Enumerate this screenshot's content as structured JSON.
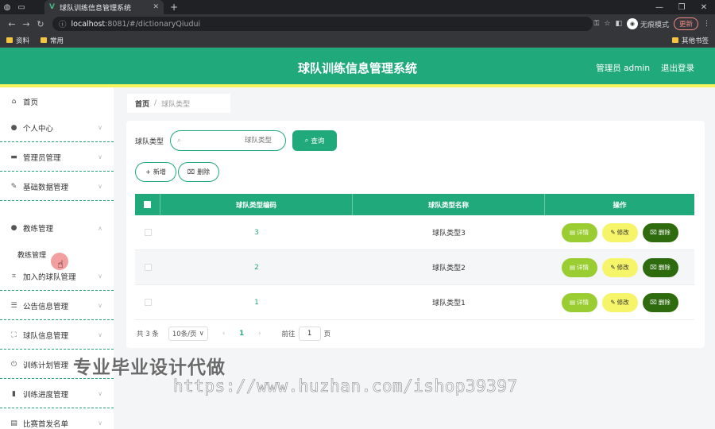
{
  "browser": {
    "tab_title": "球队训练信息管理系统",
    "tab_favicon": "V",
    "url_host": "localhost",
    "url_rest": ":8081/#/dictionaryQiudui",
    "incognito_label": "无痕模式",
    "update_label": "更新",
    "bookmarks": [
      "资料",
      "常用"
    ],
    "other_bookmarks": "其他书签"
  },
  "header": {
    "title": "球队训练信息管理系统",
    "user": "管理员 admin",
    "logout": "退出登录",
    "bg_color": "#20aa7b",
    "stripe_color": "#f5f25d"
  },
  "sidebar": {
    "items": [
      {
        "label": "首页",
        "icon": "home-icon",
        "chevron": false
      },
      {
        "label": "个人中心",
        "icon": "user-icon",
        "chevron": true
      },
      {
        "label": "管理员管理",
        "icon": "briefcase-icon",
        "chevron": true
      },
      {
        "label": "基础数据管理",
        "icon": "edit-icon",
        "chevron": true
      },
      {
        "label": "教练管理",
        "icon": "user-icon",
        "chevron": true,
        "expanded": true
      },
      {
        "label": "加入的球队管理",
        "icon": "crop-icon",
        "chevron": true
      },
      {
        "label": "公告信息管理",
        "icon": "sliders-icon",
        "chevron": true
      },
      {
        "label": "球队信息管理",
        "icon": "frame-icon",
        "chevron": true
      },
      {
        "label": "训练计划管理",
        "icon": "power-icon",
        "chevron": true
      },
      {
        "label": "训练进度管理",
        "icon": "bar-chart-icon",
        "chevron": true
      },
      {
        "label": "比赛首发名单",
        "icon": "clipboard-icon",
        "chevron": true
      }
    ],
    "sub_item": "教练管理"
  },
  "breadcrumb": {
    "home": "首页",
    "sep": "/",
    "current": "球队类型"
  },
  "search": {
    "label": "球队类型",
    "placeholder": "球队类型",
    "query_button": "查询"
  },
  "actions": {
    "add": "新增",
    "delete": "删除"
  },
  "table": {
    "headers": [
      "球队类型编码",
      "球队类型名称",
      "操作"
    ],
    "rows": [
      {
        "code": "3",
        "name": "球队类型3"
      },
      {
        "code": "2",
        "name": "球队类型2"
      },
      {
        "code": "1",
        "name": "球队类型1"
      }
    ],
    "op_detail": "详情",
    "op_edit": "修改",
    "op_delete": "删除"
  },
  "pagination": {
    "total": "共 3 条",
    "page_size": "10条/页",
    "current_page": "1",
    "goto_label": "前往",
    "goto_value": "1",
    "page_suffix": "页"
  },
  "watermark": {
    "line1": "专业毕业设计代做",
    "line2": "https://www.huzhan.com/ishop39397"
  }
}
